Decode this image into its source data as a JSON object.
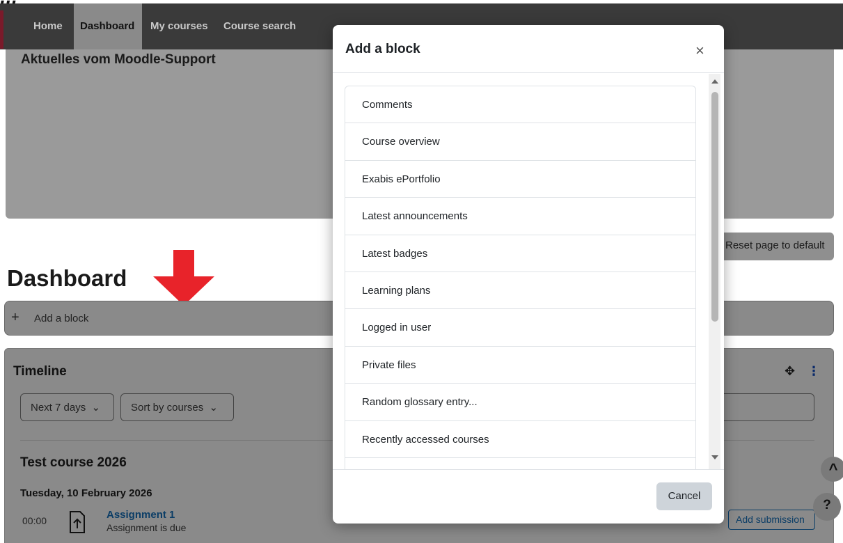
{
  "caption": {
    "text": "..."
  },
  "navbar": {
    "items": [
      {
        "label": "Home"
      },
      {
        "label": "Dashboard"
      },
      {
        "label": "My courses"
      },
      {
        "label": "Course search"
      }
    ]
  },
  "news": {
    "title": "Aktuelles vom Moodle-Support"
  },
  "page": {
    "reset_label": "Reset page to default",
    "heading": "Dashboard",
    "add_block_label": "Add a block"
  },
  "timeline": {
    "title": "Timeline",
    "filter_days": "Next 7 days",
    "filter_sort": "Sort by courses",
    "course": "Test course 2026",
    "date": "Tuesday, 10 February 2026",
    "time": "00:00",
    "assignment_name": "Assignment 1",
    "assignment_due": "Assignment is due",
    "add_submission": "Add submission"
  },
  "modal": {
    "title": "Add a block",
    "close_glyph": "×",
    "items": [
      "Comments",
      "Course overview",
      "Exabis ePortfolio",
      "Latest announcements",
      "Latest badges",
      "Learning plans",
      "Logged in user",
      "Private files",
      "Random glossary entry...",
      "Recently accessed courses",
      ""
    ],
    "cancel_label": "Cancel"
  },
  "fab": {
    "up_glyph": "^",
    "help_glyph": "?"
  },
  "icons": {
    "move": "move-icon",
    "kebab": "kebab-menu-icon",
    "plus": "plus-icon",
    "assignment": "assignment-upload-icon",
    "arrow": "red-down-arrow-icon"
  },
  "colors": {
    "accent": "#0f6cbf",
    "link": "#0b3d66",
    "arrow": "#e8232a"
  }
}
